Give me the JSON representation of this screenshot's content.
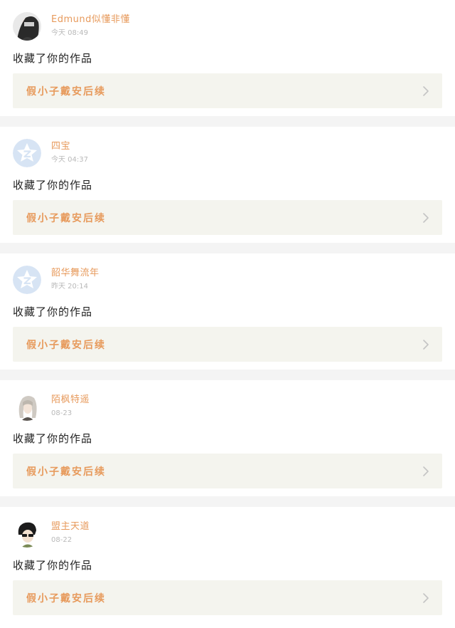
{
  "colors": {
    "accent": "#e79a5c",
    "time": "#b9b9b9",
    "text": "#222222",
    "card_bg": "#ffffff",
    "work_bg": "#f4f4ee",
    "separator": "#f4f4f4"
  },
  "notifications": [
    {
      "username": "Edmund似懂非懂",
      "time": "今天 08:49",
      "avatar": "photo-avatar-dark-hair",
      "action": "收藏了你的作品",
      "work_title": "假小子戴安后续",
      "chevron": "chevron-right-icon"
    },
    {
      "username": "四宝",
      "time": "今天 04:37",
      "avatar": "default-qq-star-avatar",
      "action": "收藏了你的作品",
      "work_title": "假小子戴安后续",
      "chevron": "chevron-right-icon"
    },
    {
      "username": "韶华舞流年",
      "time": "昨天 20:14",
      "avatar": "default-qq-star-avatar",
      "action": "收藏了你的作品",
      "work_title": "假小子戴安后续",
      "chevron": "chevron-right-icon"
    },
    {
      "username": "陌枫特遥",
      "time": "08-23",
      "avatar": "anime-avatar-silver-hair",
      "action": "收藏了你的作品",
      "work_title": "假小子戴安后续",
      "chevron": "chevron-right-icon"
    },
    {
      "username": "盟主天道",
      "time": "08-22",
      "avatar": "anime-avatar-dark-hair-glasses",
      "action": "收藏了你的作品",
      "work_title": "假小子戴安后续",
      "chevron": "chevron-right-icon"
    }
  ]
}
